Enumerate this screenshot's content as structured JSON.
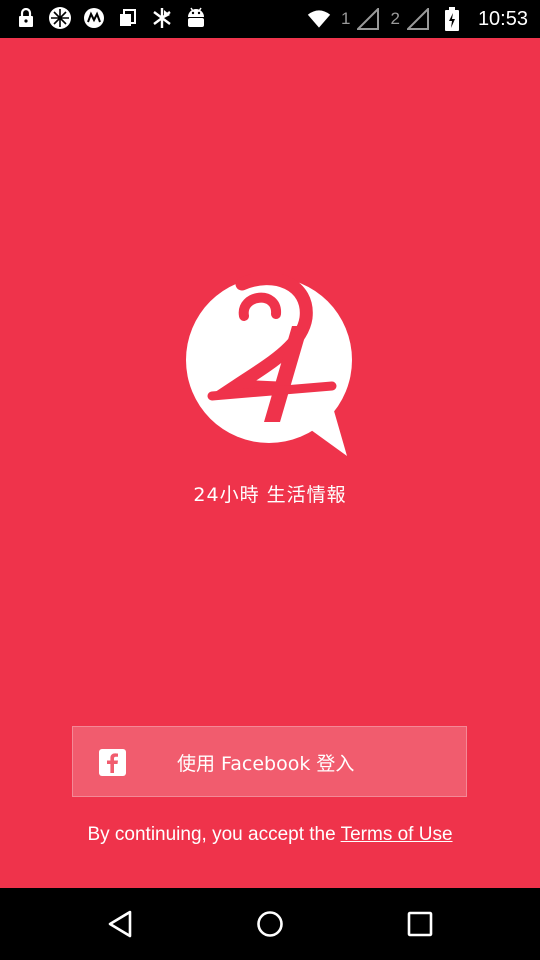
{
  "status_bar": {
    "icons_left": [
      "lock-icon",
      "app-icon",
      "motorola-icon",
      "sim-icon",
      "transfer-icon",
      "android-icon"
    ],
    "sim1": "1",
    "sim2": "2",
    "time": "10:53"
  },
  "app": {
    "background_color": "#ef334b",
    "logo": "24-logo",
    "tagline": "24小時 生活情報",
    "facebook_button": {
      "label": "使用 Facebook 登入",
      "icon": "facebook-icon"
    },
    "terms": {
      "prefix": "By continuing, you accept the",
      "link": "Terms of Use"
    }
  },
  "nav_bar": {
    "back": "back-icon",
    "home": "home-icon",
    "recents": "recents-icon"
  }
}
